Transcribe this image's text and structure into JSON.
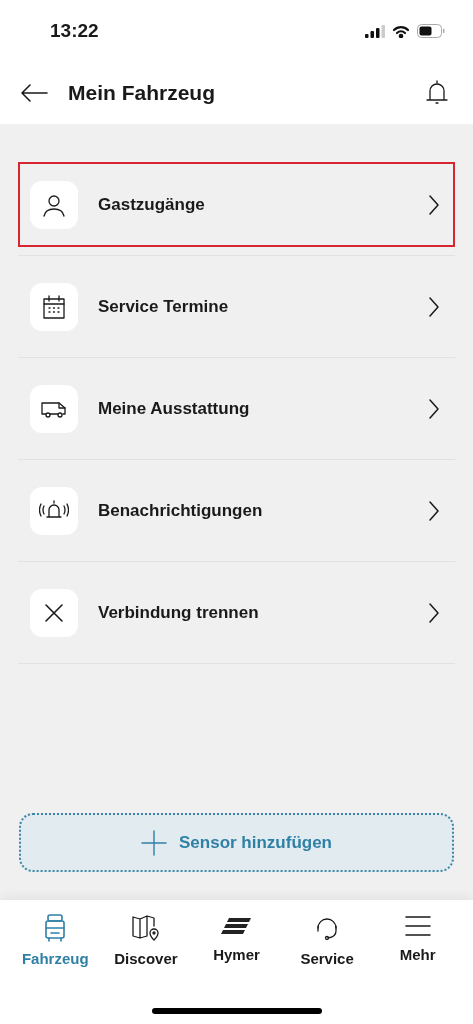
{
  "status_bar": {
    "time": "13:22"
  },
  "header": {
    "title": "Mein Fahrzeug"
  },
  "menu": [
    {
      "kind": "person",
      "label": "Gastzugänge",
      "highlighted": true
    },
    {
      "kind": "calendar",
      "label": "Service Termine",
      "highlighted": false
    },
    {
      "kind": "van",
      "label": "Meine Ausstattung",
      "highlighted": false
    },
    {
      "kind": "alarm",
      "label": "Benachrichtigungen",
      "highlighted": false
    },
    {
      "kind": "close",
      "label": "Verbindung trennen",
      "highlighted": false
    }
  ],
  "add_button": {
    "label": "Sensor hinzufügen"
  },
  "tab_bar": [
    {
      "kind": "vehicle",
      "label": "Fahrzeug",
      "selected": true
    },
    {
      "kind": "map",
      "label": "Discover",
      "selected": false
    },
    {
      "kind": "brand",
      "label": "Hymer",
      "selected": false
    },
    {
      "kind": "headset",
      "label": "Service",
      "selected": false
    },
    {
      "kind": "menu",
      "label": "Mehr",
      "selected": false
    }
  ]
}
